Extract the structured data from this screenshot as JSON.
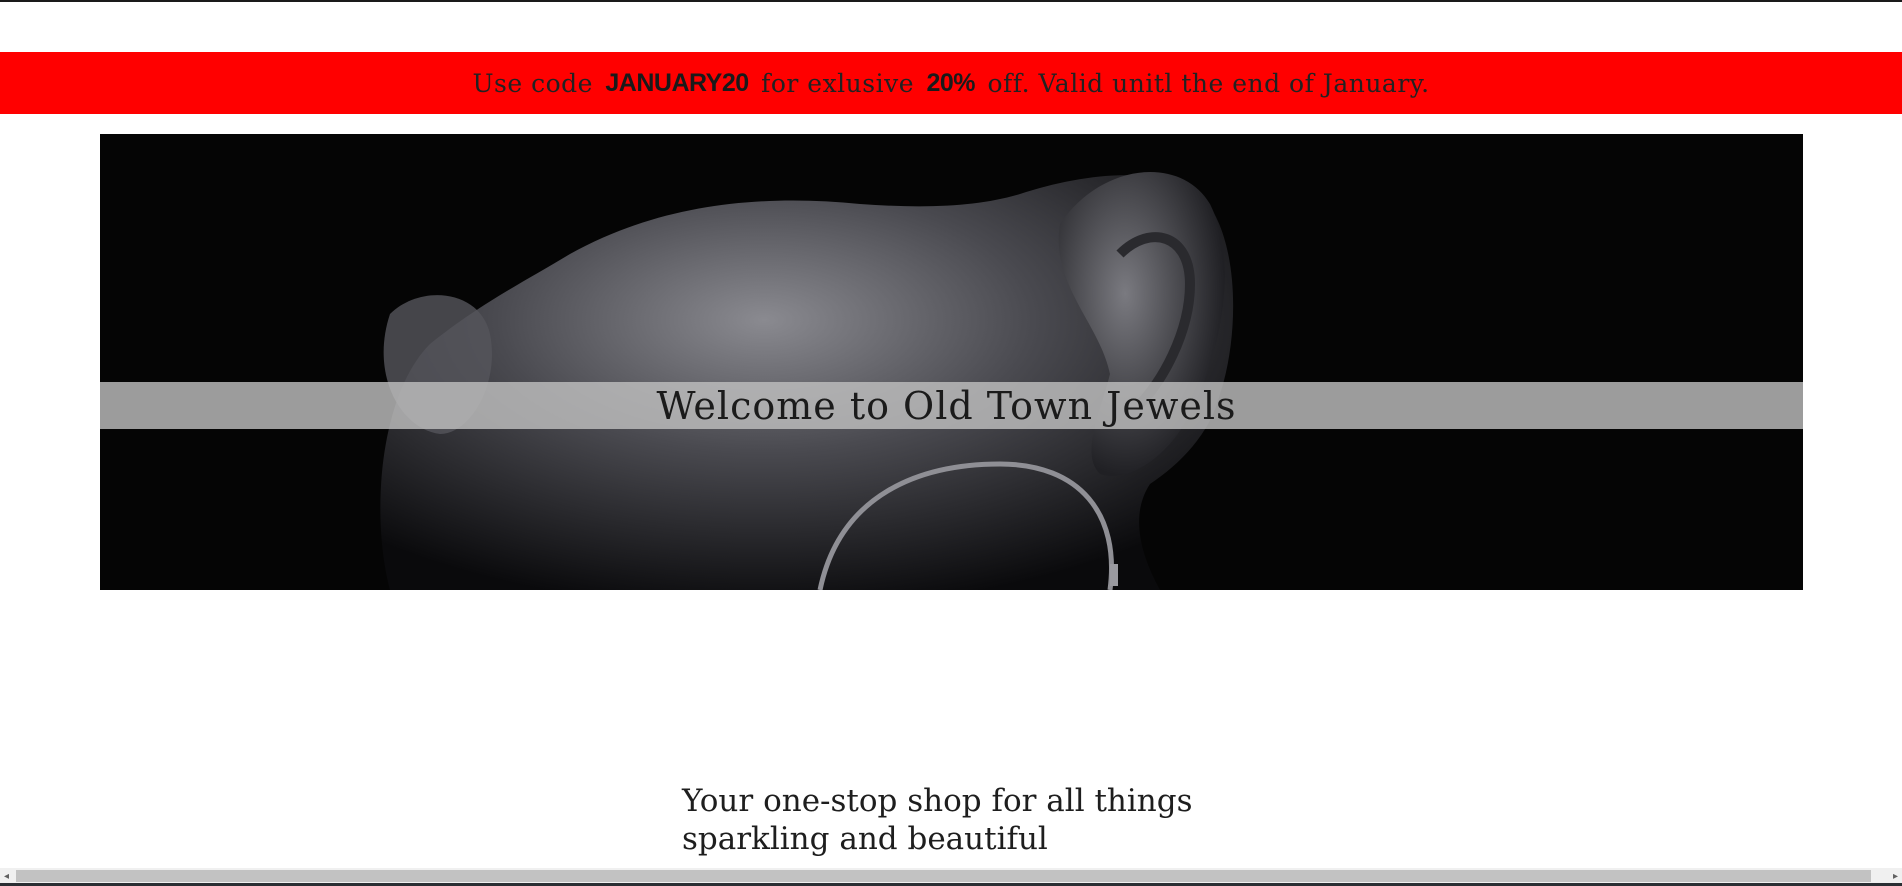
{
  "promo": {
    "text_1": "Use code",
    "code": "JANUARY20",
    "text_2": "for exlusive",
    "discount": "20%",
    "text_3": "off. Valid unitl the end of January."
  },
  "hero": {
    "title": "Welcome to Old Town Jewels"
  },
  "tagline": {
    "line_1": "Your one-stop shop for all things",
    "line_2": "sparkling and beautiful"
  },
  "colors": {
    "promo_bg": "#ff0000",
    "hero_bg": "#050505",
    "band": "#bebebe"
  }
}
